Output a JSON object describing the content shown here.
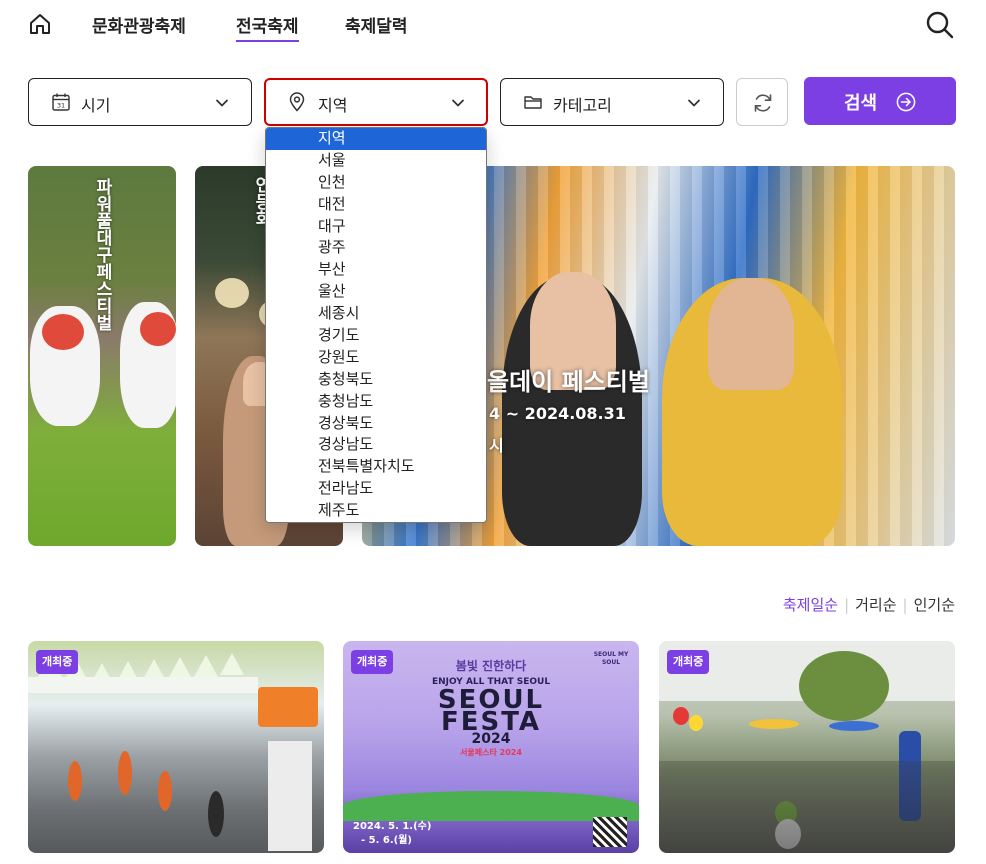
{
  "nav": {
    "links": [
      "문화관광축제",
      "전국축제",
      "축제달력"
    ],
    "active_index": 1
  },
  "filters": {
    "period_label": "시기",
    "region_label": "지역",
    "category_label": "카테고리",
    "search_label": "검색"
  },
  "region_options": [
    "지역",
    "서울",
    "인천",
    "대전",
    "대구",
    "광주",
    "부산",
    "울산",
    "세종시",
    "경기도",
    "강원도",
    "충청북도",
    "충청남도",
    "경상북도",
    "경상남도",
    "전북특별자치도",
    "전라남도",
    "제주도"
  ],
  "region_selected_index": 0,
  "hero": {
    "card1_title": "파워풀대구페스티벌",
    "card2_title": "연등회",
    "card3_title": "올데이 페스티벌",
    "card3_date": "4 ~ 2024.08.31",
    "card3_location": "시"
  },
  "sort": {
    "options": [
      "축제일순",
      "거리순",
      "인기순"
    ],
    "active_index": 0
  },
  "cards": [
    {
      "badge": "개최중"
    },
    {
      "badge": "개최중",
      "poster_small": "봄빛 진한하다",
      "poster_line": "ENJOY ALL THAT SEOUL",
      "poster_title_1": "SEOUL",
      "poster_title_2": "FESTA",
      "poster_year": "2024",
      "poster_sub": "서울페스타 2024",
      "poster_date_1": "2024. 5. 1.(수)",
      "poster_date_2": "- 5. 6.(월)",
      "poster_corner": "SEOUL MY SOUL"
    },
    {
      "badge": "개최중"
    }
  ],
  "colors": {
    "accent": "#7b3fe4",
    "dropdown_selected": "#1e66d8",
    "focus_border": "#d00000"
  }
}
